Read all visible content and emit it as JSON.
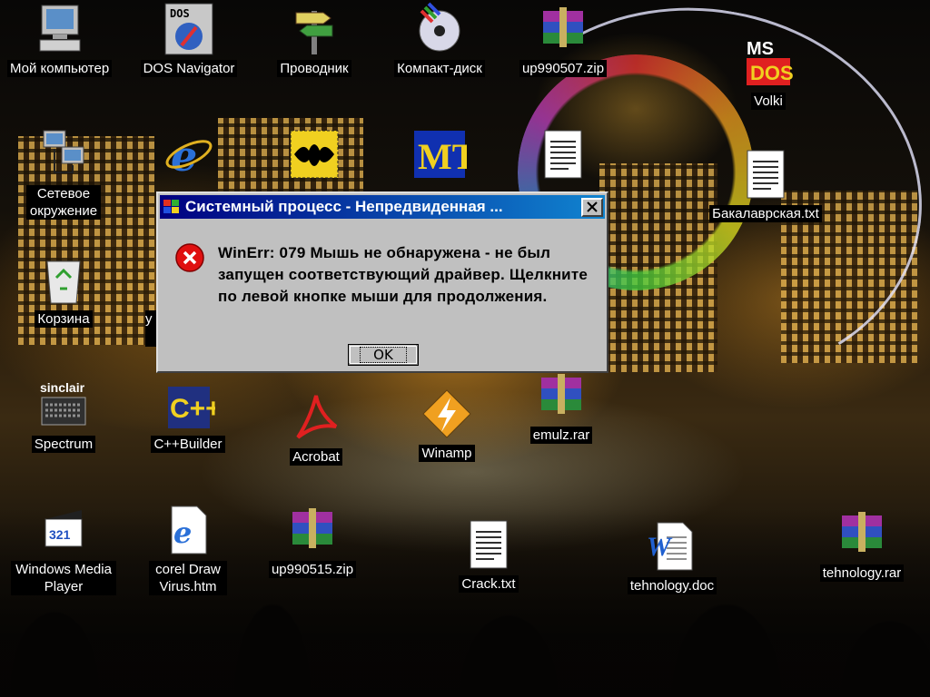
{
  "desktop": {
    "icons": [
      {
        "name": "my-computer",
        "label": "Мой компьютер"
      },
      {
        "name": "dos-navigator",
        "label": "DOS Navigator"
      },
      {
        "name": "explorer",
        "label": "Проводник"
      },
      {
        "name": "cd-drive",
        "label": "Компакт-диск"
      },
      {
        "name": "up990507",
        "label": "up990507.zip"
      },
      {
        "name": "volki",
        "label": "Volki"
      },
      {
        "name": "network",
        "label": "Сетевое окружение"
      },
      {
        "name": "bachelor-txt",
        "label": "Бакалаврская.txt"
      },
      {
        "name": "recycle-bin",
        "label": "Корзина"
      },
      {
        "name": "spectrum",
        "label": "Spectrum"
      },
      {
        "name": "cpp-builder",
        "label": "C++Builder"
      },
      {
        "name": "acrobat",
        "label": "Acrobat"
      },
      {
        "name": "winamp",
        "label": "Winamp"
      },
      {
        "name": "emulz-rar",
        "label": "emulz.rar"
      },
      {
        "name": "wmp",
        "label": "Windows Media Player"
      },
      {
        "name": "coreldraw-htm",
        "label": "corel Draw Virus.htm"
      },
      {
        "name": "up990515",
        "label": "up990515.zip"
      },
      {
        "name": "crack-txt",
        "label": "Crack.txt"
      },
      {
        "name": "tehnology-doc",
        "label": "tehnology.doc"
      },
      {
        "name": "tehnology-rar",
        "label": "tehnology.rar"
      }
    ],
    "partial_label_char": "у"
  },
  "dialog": {
    "title": "Системный процесс - Непредвиденная ...",
    "message": "WinErr: 079 Мышь не обнаружена - не был запущен соответствующий драйвер. Щелкните по левой кнопке мыши для продолжения.",
    "ok_label": "OK",
    "close_glyph": "✕"
  },
  "colors": {
    "titlebar_start": "#000080",
    "titlebar_end": "#1084d0",
    "dialog_face": "#c0c0c0",
    "error_red": "#e01010"
  }
}
